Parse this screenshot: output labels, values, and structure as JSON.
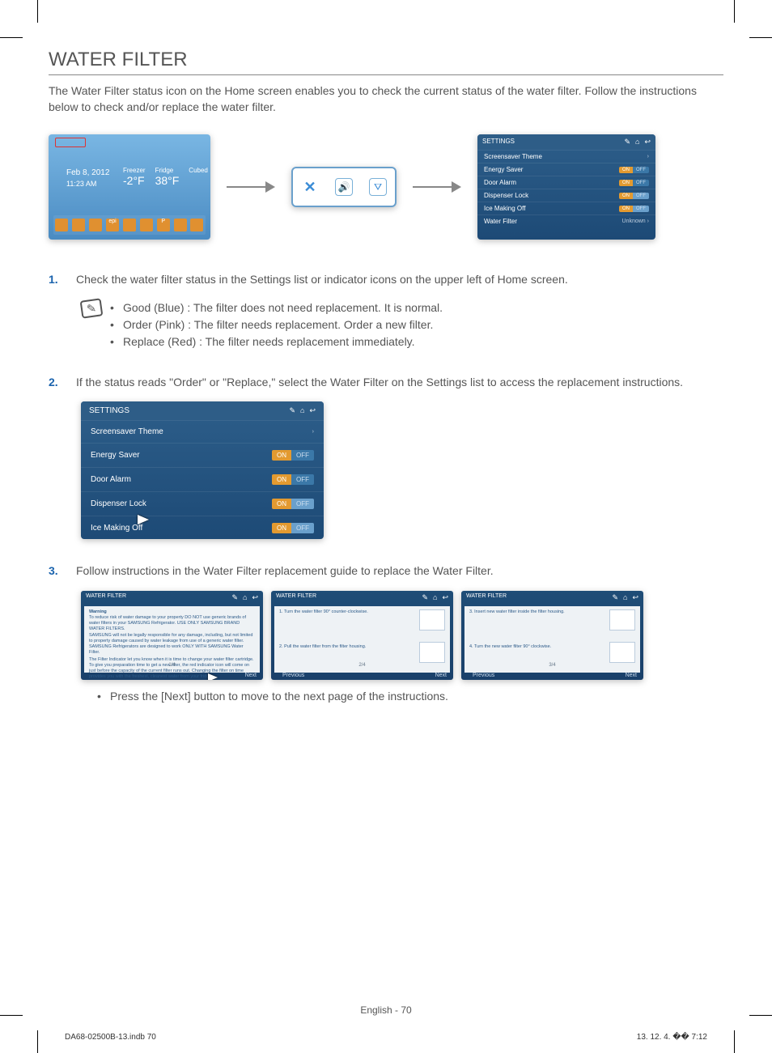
{
  "title": "WATER FILTER",
  "intro": "The Water Filter status icon on the Home screen enables you to check the current status of the water filter. Follow the instructions below to check and/or replace the water filter.",
  "home": {
    "date": "Feb 8, 2012",
    "time": "11:23 AM",
    "w1label": "Freezer",
    "w2label": "Fridge",
    "w3label": "Cubed",
    "t1": "-2°F",
    "t2": "38°F",
    "apps": [
      "",
      "",
      "",
      "epi",
      "",
      "",
      "P",
      "",
      ""
    ]
  },
  "icons": {
    "x": "✕",
    "sound": "🔊",
    "filter": "⛛"
  },
  "settings_small": {
    "title": "SETTINGS",
    "screensaver": "Screensaver Theme",
    "energy": "Energy Saver",
    "door": "Door Alarm",
    "lock": "Dispenser Lock",
    "ice": "Ice Making Off",
    "water": "Water Filter",
    "on": "ON",
    "off": "OFF",
    "unknown": "Unknown"
  },
  "step1": "Check the water filter status in the Settings list or indicator icons on the upper left of Home screen.",
  "status": {
    "good": "Good (Blue) : The filter does not need replacement. It is normal.",
    "order": "Order (Pink) : The filter needs replacement. Order a new filter.",
    "replace": "Replace (Red) : The filter needs replacement immediately."
  },
  "step2": "If the status reads \"Order\" or \"Replace,\" select the Water Filter on the Settings list to access the replacement instructions.",
  "step3": "Follow instructions in the Water Filter replacement guide to replace the Water Filter.",
  "guide": {
    "title": "WATER FILTER",
    "next": "Next",
    "prev": "Previous",
    "p1": {
      "page": "1/4",
      "warn": "Warning",
      "l1": "To reduce risk of water damage to your property DO NOT use generic brands of water filters in your SAMSUNG Refrigerator. USE ONLY SAMSUNG BRAND WATER FILTERS.",
      "l2": "SAMSUNG will not be legally responsible for any damage, including, but not limited to property damage caused by water leakage from use of a generic water filter. SAMSUNG Refrigerators are designed to work ONLY WITH SAMSUNG Water Filter.",
      "l3": "The Filter Indicator let you know when it is time to change your water filter cartridge. To give you preparation time to get a new filter, the red indicator icon will come on just before the capacity of the current filter runs out. Changing the filter on time provides you with the freshest, cleanest water from your fridge."
    },
    "p2": {
      "page": "2/4",
      "s1": "1. Turn the water filter 90° counter-clockwise.",
      "s2": "2. Pull the water filter from the filter housing."
    },
    "p3": {
      "page": "3/4",
      "s1": "3. Insert new water filter inside the filter housing.",
      "s2": "4. Turn the new water filter 90° clockwise."
    }
  },
  "press_next": "Press the [Next] button to move to the next page of the instructions.",
  "footer": "English - 70",
  "print_left": "DA68-02500B-13.indb   70",
  "print_right": "13. 12. 4.   �� 7:12",
  "nums": {
    "n1": "1.",
    "n2": "2.",
    "n3": "3."
  },
  "chev": "›",
  "hdr_icons": {
    "edit": "✎",
    "home": "⌂",
    "back": "↩"
  }
}
